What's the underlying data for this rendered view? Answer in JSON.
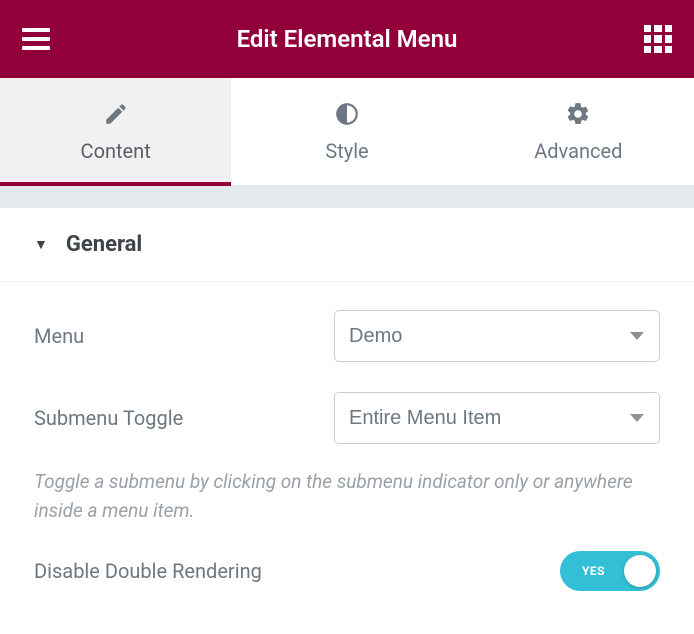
{
  "header": {
    "title": "Edit Elemental Menu"
  },
  "tabs": {
    "content": "Content",
    "style": "Style",
    "advanced": "Advanced"
  },
  "section": {
    "title": "General"
  },
  "form": {
    "menu": {
      "label": "Menu",
      "value": "Demo"
    },
    "submenu_toggle": {
      "label": "Submenu Toggle",
      "value": "Entire Menu Item",
      "help": "Toggle a submenu by clicking on the submenu indicator only or anywhere inside a menu item."
    },
    "disable_double_rendering": {
      "label": "Disable Double Rendering",
      "state_text": "YES"
    }
  }
}
